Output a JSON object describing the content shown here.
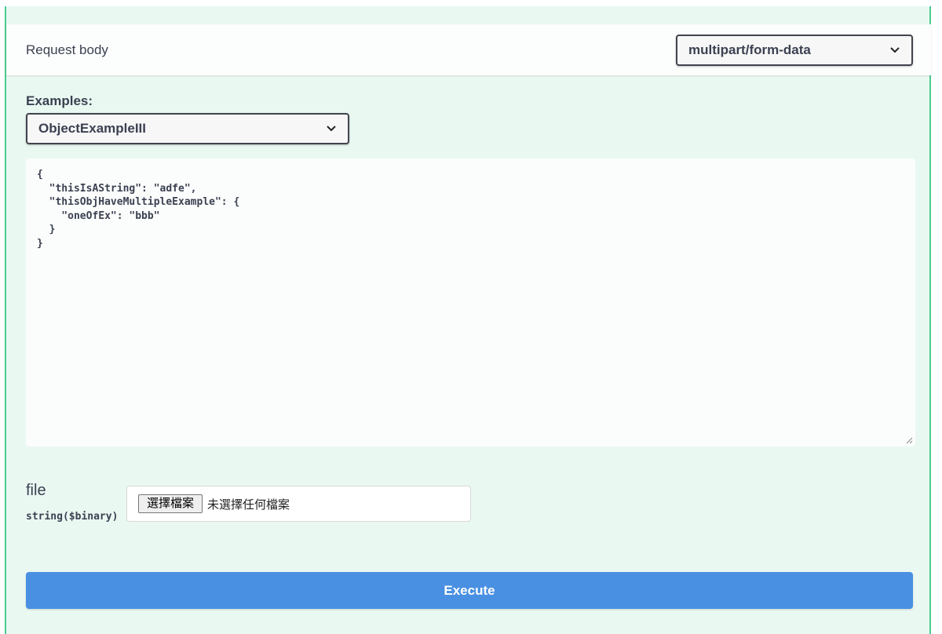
{
  "request_body": {
    "title": "Request body",
    "content_type": "multipart/form-data"
  },
  "examples": {
    "label": "Examples:",
    "selected": "ObjectExampleIII"
  },
  "editor": {
    "value": "{\n  \"thisIsAString\": \"adfe\",\n  \"thisObjHaveMultipleExample\": {\n    \"oneOfEx\": \"bbb\"\n  }\n}"
  },
  "param": {
    "name": "file",
    "type": "string($binary)",
    "file_button": "選擇檔案",
    "file_status": "未選擇任何檔案"
  },
  "execute": {
    "label": "Execute"
  },
  "icons": {
    "select_chevron": "chevron-down-icon",
    "resize": "resize-handle-icon"
  },
  "colors": {
    "panel_bg": "#eaf8f2",
    "panel_border": "#49cc90",
    "execute_bg": "#4990e2",
    "text": "#3b4151"
  }
}
